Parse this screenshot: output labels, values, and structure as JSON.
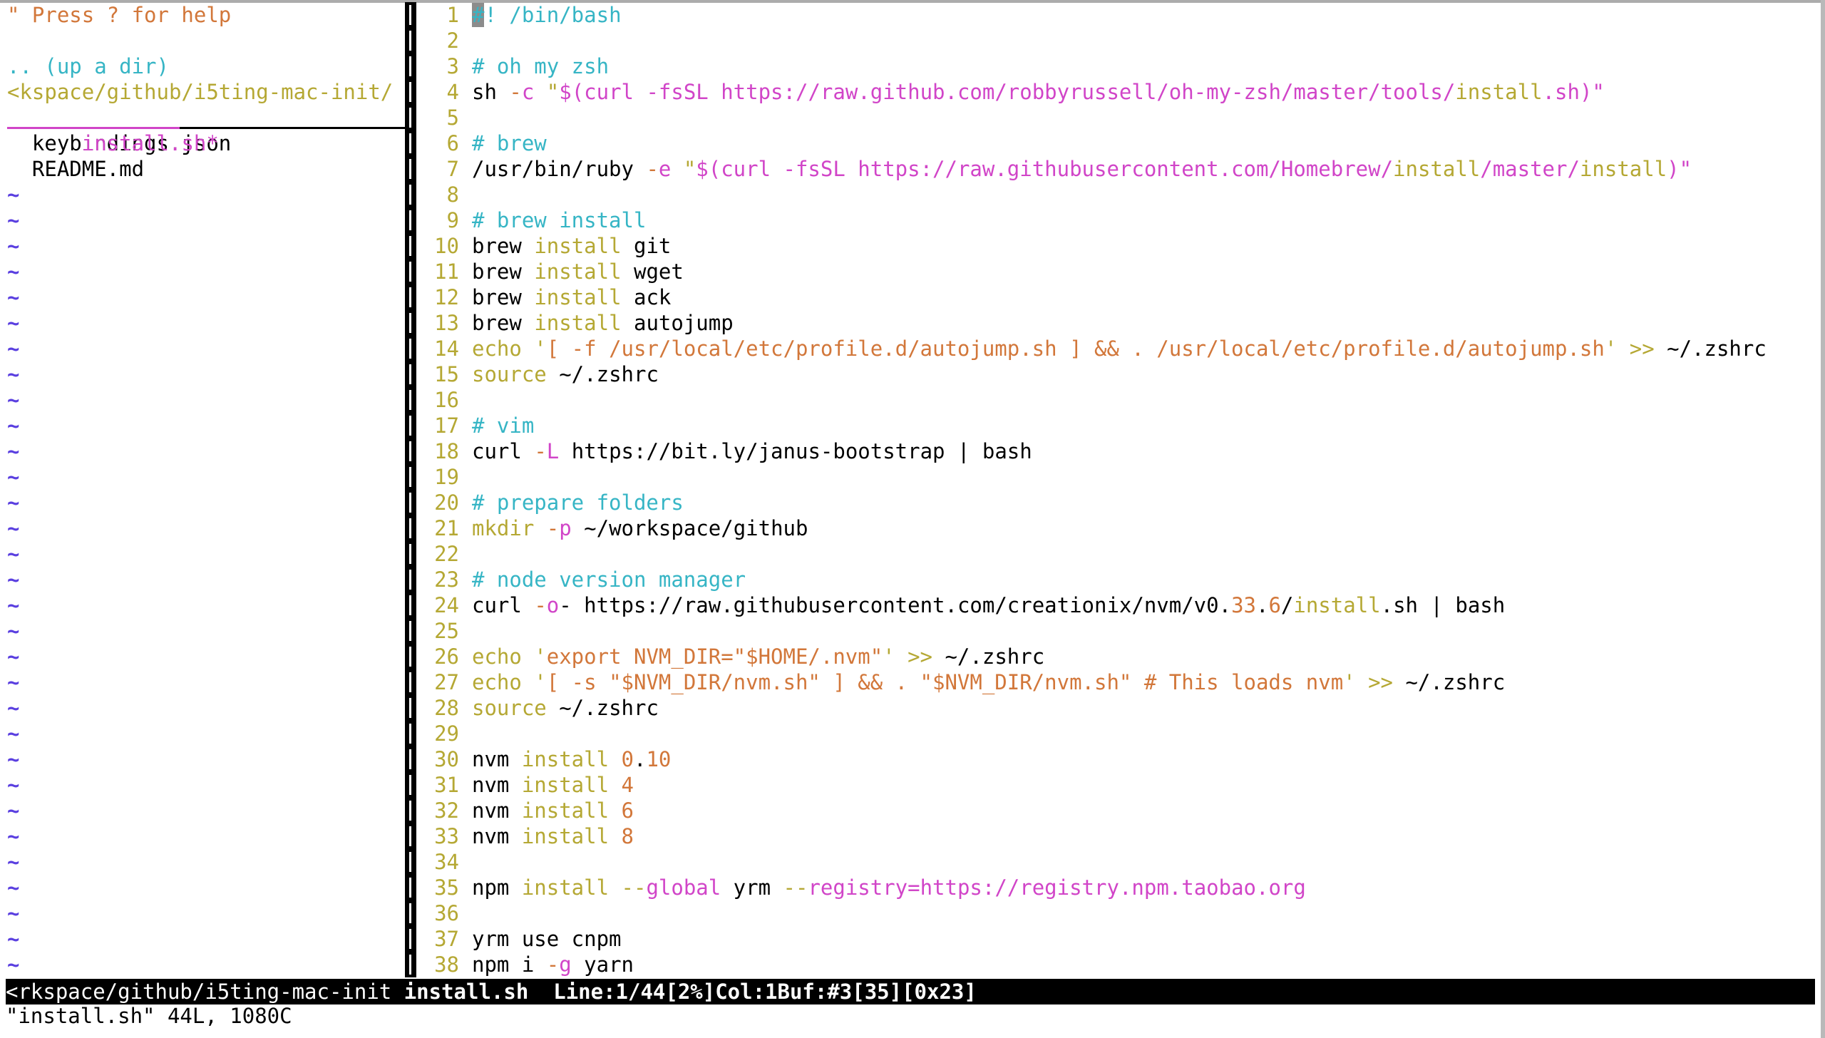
{
  "tree": {
    "help": "\" Press ? for help",
    "blank": "",
    "up_dir": ".. (up a dir)",
    "cwd": "<kspace/github/i5ting-mac-init/",
    "entries": [
      {
        "name": "  install.sh*",
        "current": true
      },
      {
        "name": "  keybindings.json",
        "current": false
      },
      {
        "name": "  README.md",
        "current": false
      }
    ],
    "filler": "~",
    "filler_rows": 31
  },
  "editor": {
    "lines": [
      {
        "n": "1",
        "tokens": [
          [
            "cursor-cm",
            "#"
          ],
          [
            "cm",
            "! /bin/bash"
          ]
        ]
      },
      {
        "n": "2",
        "tokens": []
      },
      {
        "n": "3",
        "tokens": [
          [
            "cm",
            "# oh my zsh"
          ]
        ]
      },
      {
        "n": "4",
        "tokens": [
          [
            "n",
            "sh "
          ],
          [
            "dash",
            "-"
          ],
          [
            "st",
            "c "
          ],
          [
            "kw",
            "\""
          ],
          [
            "st",
            "$(curl -fsSL https://raw.github.com/robbyrussell/oh-my-zsh/master/tools/"
          ],
          [
            "kw",
            "install"
          ],
          [
            "st",
            ".sh)\""
          ]
        ]
      },
      {
        "n": "5",
        "tokens": []
      },
      {
        "n": "6",
        "tokens": [
          [
            "cm",
            "# brew"
          ]
        ]
      },
      {
        "n": "7",
        "tokens": [
          [
            "n",
            "/usr/bin/ruby "
          ],
          [
            "dash",
            "-"
          ],
          [
            "st",
            "e "
          ],
          [
            "kw",
            "\""
          ],
          [
            "st",
            "$(curl -fsSL https://raw.githubusercontent.com/Homebrew/"
          ],
          [
            "kw",
            "install"
          ],
          [
            "st",
            "/master/"
          ],
          [
            "kw",
            "install"
          ],
          [
            "st",
            ")\""
          ]
        ]
      },
      {
        "n": "8",
        "tokens": []
      },
      {
        "n": "9",
        "tokens": [
          [
            "cm",
            "# brew install"
          ]
        ]
      },
      {
        "n": "10",
        "tokens": [
          [
            "n",
            "brew "
          ],
          [
            "kw",
            "install"
          ],
          [
            "n",
            " git"
          ]
        ]
      },
      {
        "n": "11",
        "tokens": [
          [
            "n",
            "brew "
          ],
          [
            "kw",
            "install"
          ],
          [
            "n",
            " wget"
          ]
        ]
      },
      {
        "n": "12",
        "tokens": [
          [
            "n",
            "brew "
          ],
          [
            "kw",
            "install"
          ],
          [
            "n",
            " ack"
          ]
        ]
      },
      {
        "n": "13",
        "tokens": [
          [
            "n",
            "brew "
          ],
          [
            "kw",
            "install"
          ],
          [
            "n",
            " autojump"
          ]
        ]
      },
      {
        "n": "14",
        "tokens": [
          [
            "kw",
            "echo '"
          ],
          [
            "sq",
            "[ -f /usr/local/etc/profile.d/autojump.sh ] && . /usr/local/etc/profile.d/autojump.sh"
          ],
          [
            "kw",
            "' >>"
          ],
          [
            "n",
            " ~/.zshrc"
          ]
        ]
      },
      {
        "n": "15",
        "tokens": [
          [
            "kw",
            "source"
          ],
          [
            "n",
            " ~/.zshrc"
          ]
        ]
      },
      {
        "n": "16",
        "tokens": []
      },
      {
        "n": "17",
        "tokens": [
          [
            "cm",
            "# vim"
          ]
        ]
      },
      {
        "n": "18",
        "tokens": [
          [
            "n",
            "curl "
          ],
          [
            "dash",
            "-"
          ],
          [
            "st",
            "L"
          ],
          [
            "n",
            " https://bit.ly/janus-bootstrap | bash"
          ]
        ]
      },
      {
        "n": "19",
        "tokens": []
      },
      {
        "n": "20",
        "tokens": [
          [
            "cm",
            "# prepare folders"
          ]
        ]
      },
      {
        "n": "21",
        "tokens": [
          [
            "kw",
            "mkdir"
          ],
          [
            "n",
            " "
          ],
          [
            "dash",
            "-"
          ],
          [
            "st",
            "p"
          ],
          [
            "n",
            " ~/workspace/github"
          ]
        ]
      },
      {
        "n": "22",
        "tokens": []
      },
      {
        "n": "23",
        "tokens": [
          [
            "cm",
            "# node version manager"
          ]
        ]
      },
      {
        "n": "24",
        "tokens": [
          [
            "n",
            "curl "
          ],
          [
            "dash",
            "-"
          ],
          [
            "st",
            "o"
          ],
          [
            "n",
            "- https://raw.githubusercontent.com/creationix/nvm/v0."
          ],
          [
            "num",
            "33"
          ],
          [
            "n",
            "."
          ],
          [
            "num",
            "6"
          ],
          [
            "n",
            "/"
          ],
          [
            "kw",
            "install"
          ],
          [
            "n",
            ".sh | bash"
          ]
        ]
      },
      {
        "n": "25",
        "tokens": []
      },
      {
        "n": "26",
        "tokens": [
          [
            "kw",
            "echo '"
          ],
          [
            "sq",
            "export NVM_DIR=\"$HOME/.nvm\""
          ],
          [
            "kw",
            "' >>"
          ],
          [
            "n",
            " ~/.zshrc"
          ]
        ]
      },
      {
        "n": "27",
        "tokens": [
          [
            "kw",
            "echo '"
          ],
          [
            "sq",
            "[ -s \"$NVM_DIR/nvm.sh\" ] && . \"$NVM_DIR/nvm.sh\" # This loads nvm"
          ],
          [
            "kw",
            "' >>"
          ],
          [
            "n",
            " ~/.zshrc"
          ]
        ]
      },
      {
        "n": "28",
        "tokens": [
          [
            "kw",
            "source"
          ],
          [
            "n",
            " ~/.zshrc"
          ]
        ]
      },
      {
        "n": "29",
        "tokens": []
      },
      {
        "n": "30",
        "tokens": [
          [
            "n",
            "nvm "
          ],
          [
            "kw",
            "install"
          ],
          [
            "n",
            " "
          ],
          [
            "num",
            "0"
          ],
          [
            "n",
            "."
          ],
          [
            "num",
            "10"
          ]
        ]
      },
      {
        "n": "31",
        "tokens": [
          [
            "n",
            "nvm "
          ],
          [
            "kw",
            "install"
          ],
          [
            "n",
            " "
          ],
          [
            "num",
            "4"
          ]
        ]
      },
      {
        "n": "32",
        "tokens": [
          [
            "n",
            "nvm "
          ],
          [
            "kw",
            "install"
          ],
          [
            "n",
            " "
          ],
          [
            "num",
            "6"
          ]
        ]
      },
      {
        "n": "33",
        "tokens": [
          [
            "n",
            "nvm "
          ],
          [
            "kw",
            "install"
          ],
          [
            "n",
            " "
          ],
          [
            "num",
            "8"
          ]
        ]
      },
      {
        "n": "34",
        "tokens": []
      },
      {
        "n": "35",
        "tokens": [
          [
            "n",
            "npm "
          ],
          [
            "kw",
            "install"
          ],
          [
            "n",
            " "
          ],
          [
            "kw",
            "--"
          ],
          [
            "st",
            "global"
          ],
          [
            "n",
            " yrm "
          ],
          [
            "kw",
            "--"
          ],
          [
            "st",
            "registry=https://registry.npm.taobao.org"
          ]
        ]
      },
      {
        "n": "36",
        "tokens": []
      },
      {
        "n": "37",
        "tokens": [
          [
            "n",
            "yrm use cnpm"
          ]
        ]
      },
      {
        "n": "38",
        "tokens": [
          [
            "n",
            "npm i "
          ],
          [
            "dash",
            "-"
          ],
          [
            "st",
            "g"
          ],
          [
            "n",
            " yarn"
          ]
        ]
      }
    ]
  },
  "statusline": {
    "path": "<rkspace/github/i5ting-mac-init ",
    "file": "install.sh",
    "info": "  Line:1/44[2%]Col:1Buf:#3[35][0x23]"
  },
  "cmdline": "\"install.sh\" 44L, 1080C",
  "colors": {
    "comment": "#36b5c5",
    "keyword": "#b5a834",
    "string": "#d145c8",
    "single_quoted": "#d2773a",
    "tilde": "#5a3fe0"
  }
}
